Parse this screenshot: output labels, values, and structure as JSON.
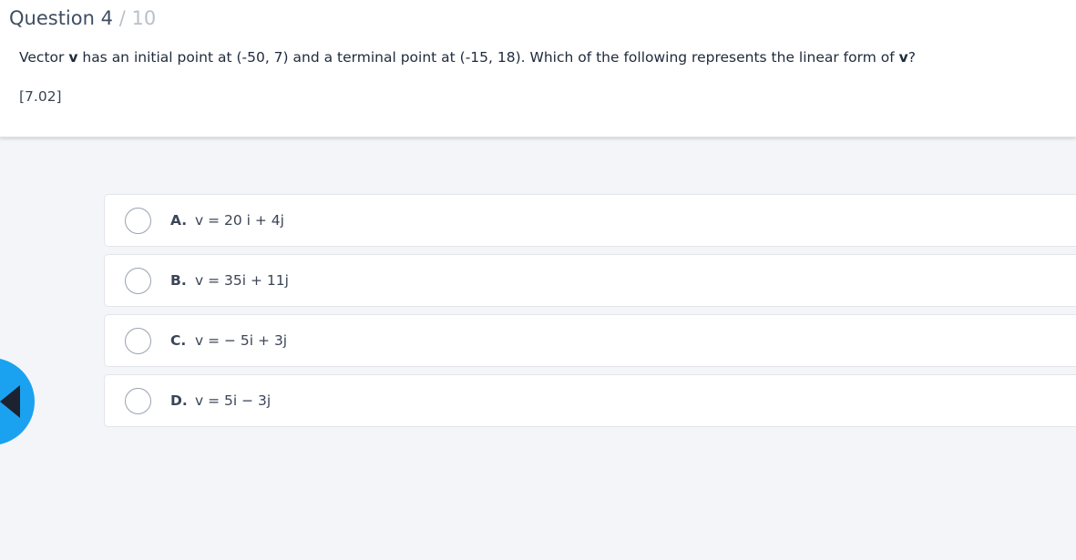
{
  "header": {
    "label": "Question",
    "number": "4",
    "separator": "/",
    "total": "10"
  },
  "question": {
    "part1": "Vector ",
    "bold1": "v",
    "part2": " has an initial point at (-50, 7) and a terminal point at (-15, 18). Which of the following represents the linear form of ",
    "bold2": "v",
    "part3": "?",
    "reference": "[7.02]"
  },
  "choices": [
    {
      "letter": "A.",
      "text": "v = 20 i + 4j"
    },
    {
      "letter": "B.",
      "text": "v = 35i + 11j"
    },
    {
      "letter": "C.",
      "text": "v = − 5i + 3j"
    },
    {
      "letter": "D.",
      "text": "v = 5i − 3j"
    }
  ],
  "nav": {
    "prev_icon": "triangle-left-icon",
    "prev_color": "#1aa2f0"
  },
  "colors": {
    "background": "#f4f5f9",
    "panel": "#ffffff",
    "accent": "#1aa2f0"
  }
}
